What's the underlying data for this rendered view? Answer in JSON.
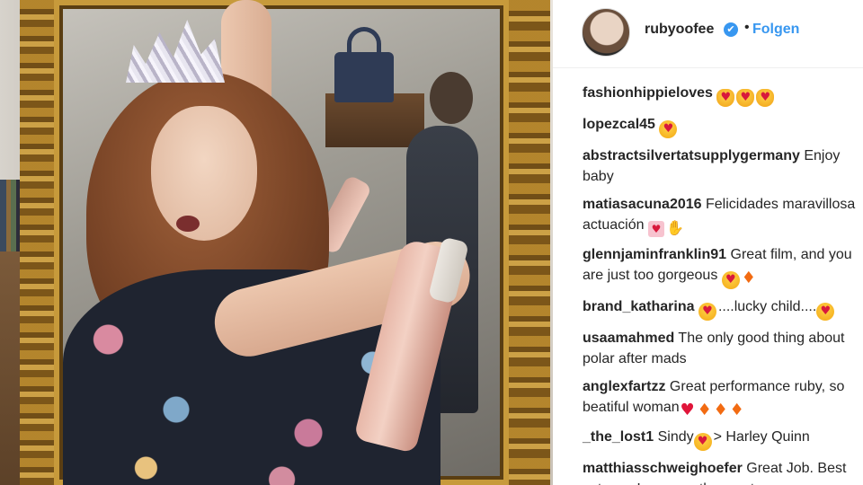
{
  "post": {
    "username": "ruby​oo​fee",
    "follow_label": "Folgen",
    "separator": "•",
    "verified_glyph": "✔"
  },
  "comments": [
    {
      "user": "fashionhippieloves",
      "text": "",
      "emojis": [
        "cat-heart-eyes",
        "cat-heart-eyes",
        "cat-heart-eyes"
      ]
    },
    {
      "user": "lopezcal45",
      "text": "",
      "emojis": [
        "heart-eyes"
      ]
    },
    {
      "user": "abstractsilvertatsupplygermany",
      "text": "Enjoy baby",
      "emojis": []
    },
    {
      "user": "matiasacuna2016",
      "text": "Felicidades maravillosa actuación",
      "emojis": [
        "love-letter",
        "clap"
      ]
    },
    {
      "user": "glennjaminfranklin91",
      "text": "Great film, and you are just too gorgeous",
      "emojis": [
        "heart-eyes",
        "fire"
      ]
    },
    {
      "user": "brand_katharina",
      "text": "....lucky child....",
      "emojis_before": [
        "heart-eyes"
      ],
      "emojis": [
        "heart-eyes"
      ]
    },
    {
      "user": "usaamahmed",
      "text": "The only good thing about polar after mads",
      "emojis": []
    },
    {
      "user": "anglexfartzz",
      "text": "Great performance ruby, so beatiful woman",
      "emojis": [
        "red-heart",
        "fire",
        "fire",
        "fire"
      ]
    },
    {
      "user": "_the_lost1",
      "text_before": "Sindy",
      "text": "> Harley Quinn",
      "emojis_mid": [
        "heart-eyes"
      ]
    },
    {
      "user": "matthiasschweighoefer",
      "text": "Great Job. Best actress. Love you the most.",
      "emojis": []
    }
  ],
  "emoji_glyphs": {
    "heart-eyes": "♥",
    "cat-heart-eyes": "♥",
    "fire": "♦",
    "red-heart": "♥",
    "clap": "✋",
    "love-letter": "♥"
  },
  "colors": {
    "accent": "#3897f0",
    "text": "#262626",
    "border": "#efefef"
  }
}
